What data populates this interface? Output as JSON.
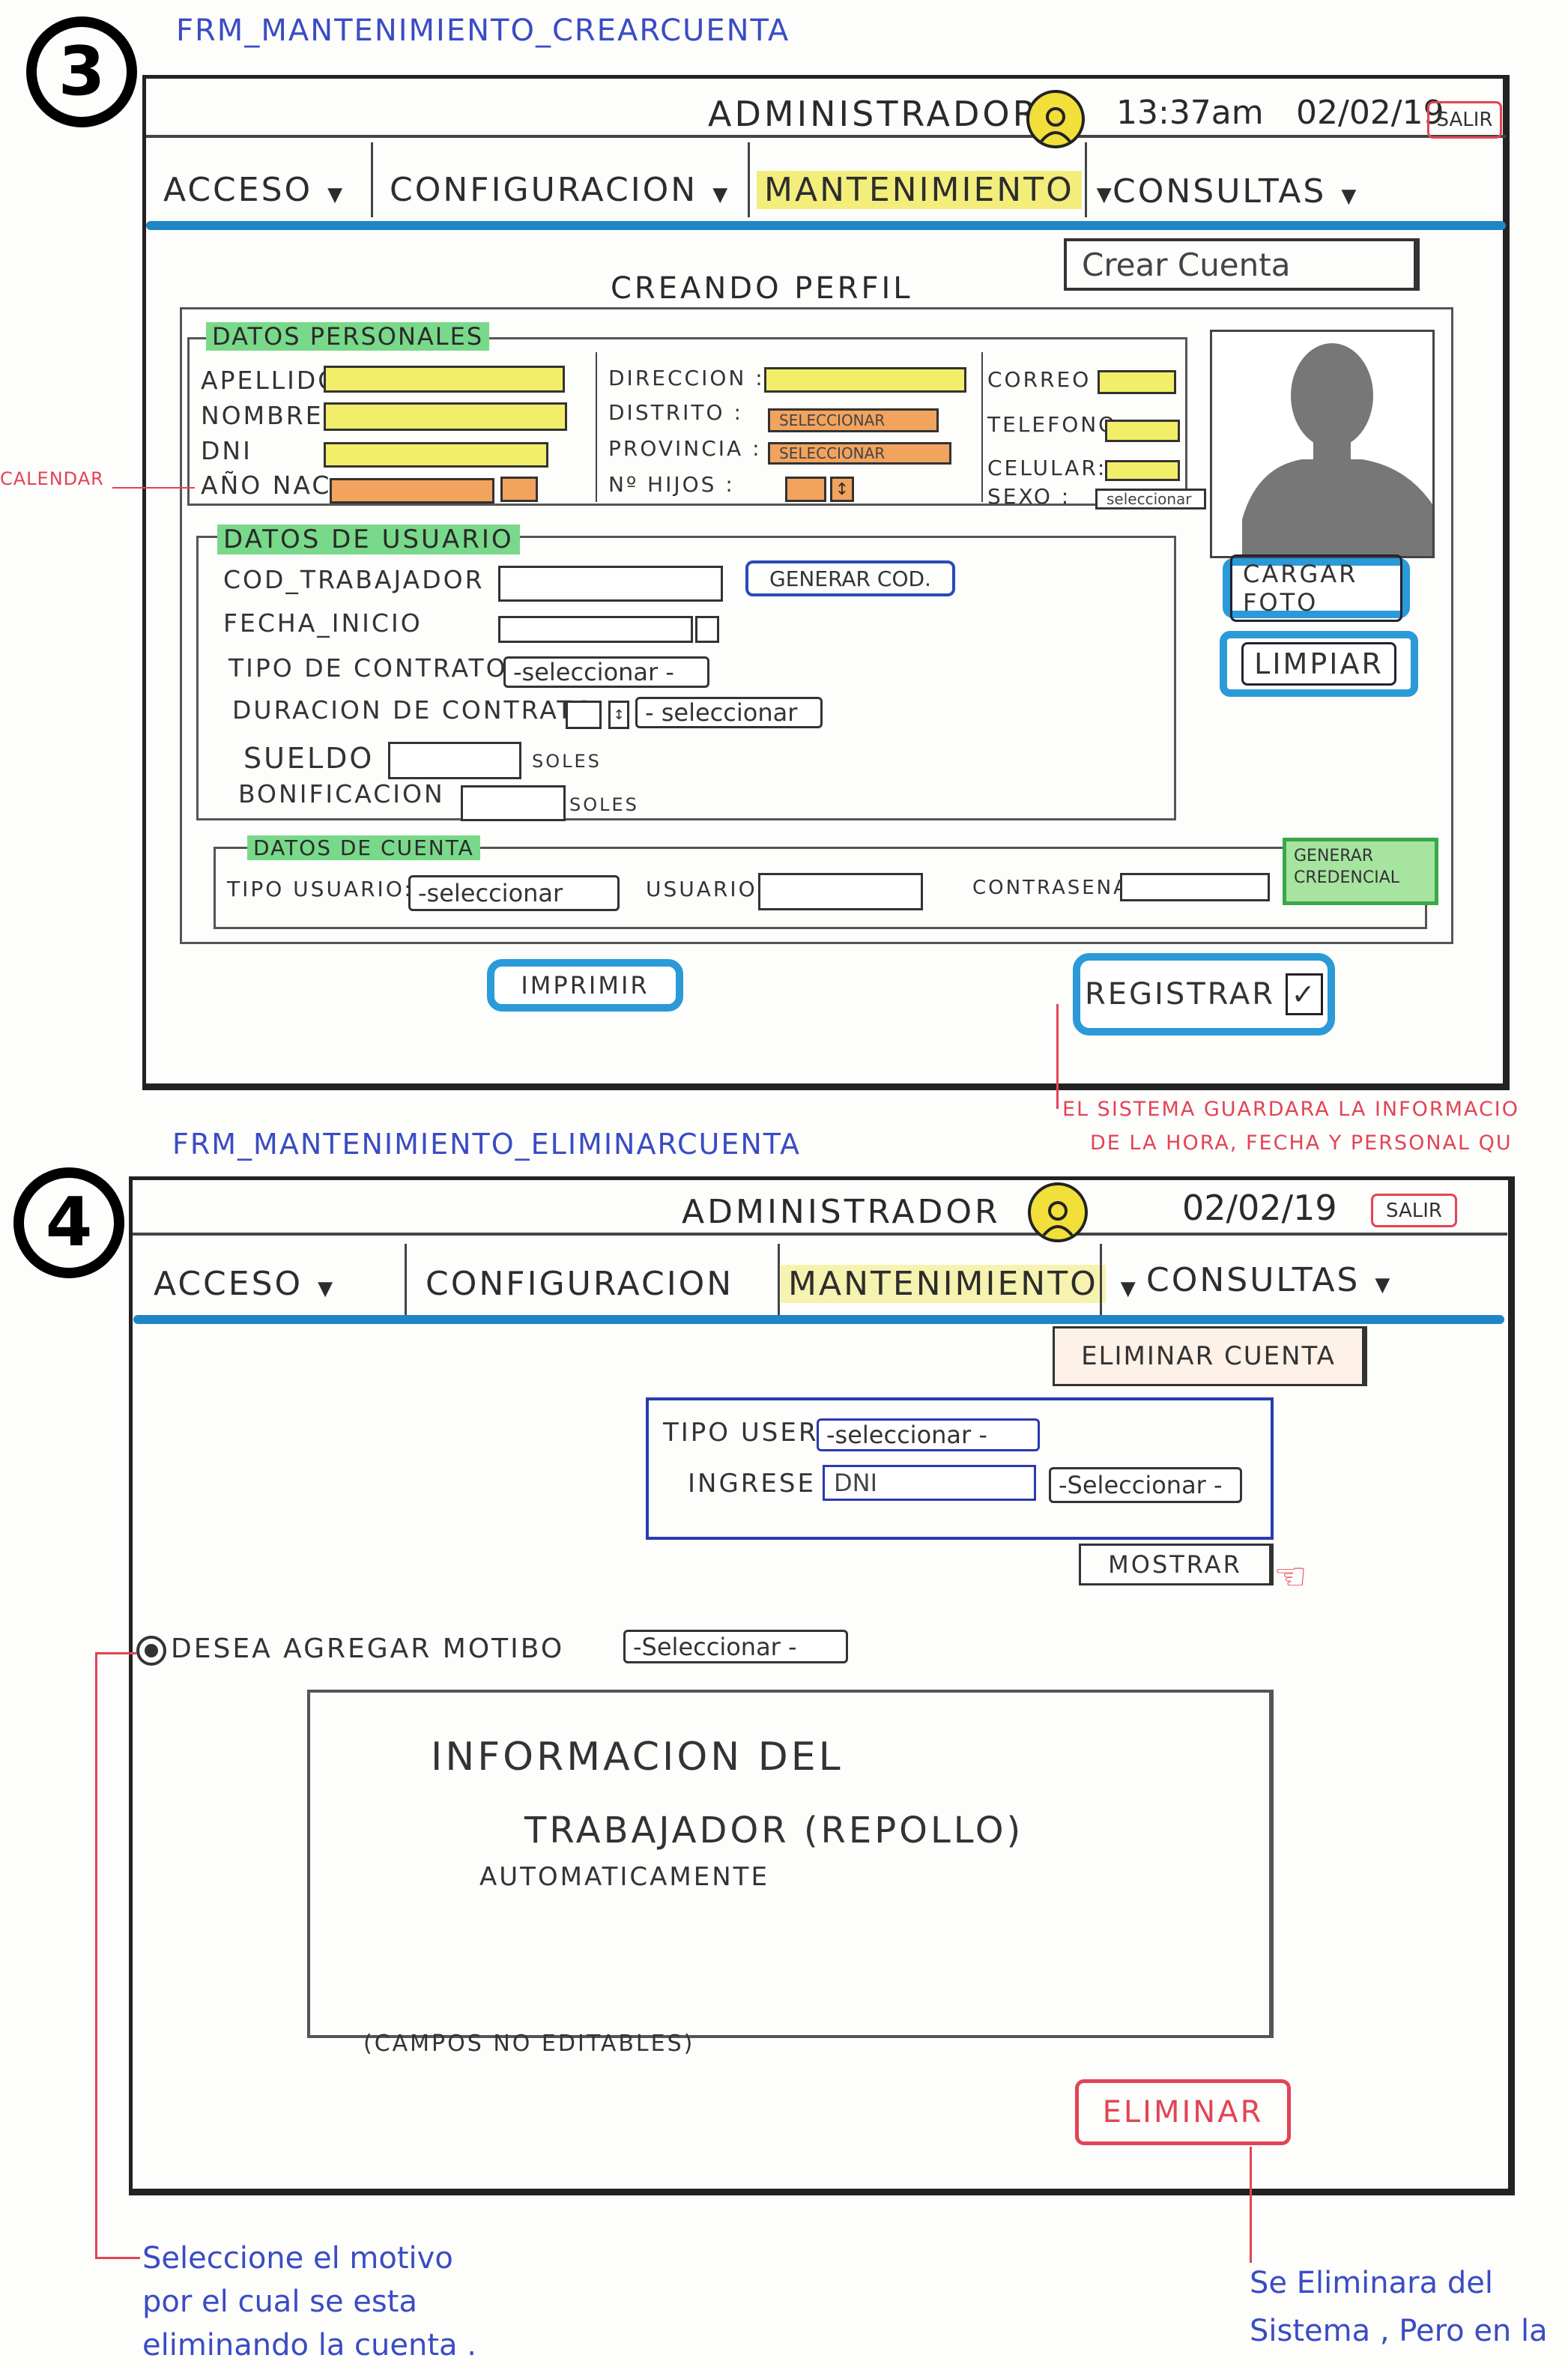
{
  "screen3": {
    "number": "3",
    "form_name": "FRM_MANTENIMIENTO_CREARCUENTA",
    "header": {
      "user_role": "ADMINISTRADOR",
      "time": "13:37am",
      "date": "02/02/19",
      "logout_label": "SALIR"
    },
    "menu": {
      "acceso": "ACCESO",
      "configuracion": "CONFIGURACION",
      "mantenimiento": "MANTENIMIENTO",
      "consultas": "CONSULTAS"
    },
    "submenu_item": "Crear Cuenta",
    "page_title": "CREANDO PERFIL",
    "datos_personales": {
      "title": "DATOS PERSONALES",
      "apellido": "APELLIDO",
      "nombre": "NOMBRE",
      "dni": "DNI",
      "ano_nac": "AÑO NAC",
      "direccion": "DIRECCION :",
      "distrito": "DISTRITO :",
      "distrito_value": "SELECCIONAR",
      "provincia": "PROVINCIA :",
      "provincia_value": "SELECCIONAR",
      "n_hijos": "Nº HIJOS :",
      "correo": "CORREO :",
      "telefono": "TELEFONO:",
      "celular": "CELULAR:",
      "sexo": "SEXO :",
      "sexo_value": "seleccionar"
    },
    "calendar_note": "CALENDAR",
    "photo_buttons": {
      "cargar_foto": "CARGAR FOTO",
      "limpiar": "LIMPIAR"
    },
    "datos_usuario": {
      "title": "DATOS DE USUARIO",
      "cod_trabajador": "COD_TRABAJADOR",
      "generar_cod": "GENERAR COD.",
      "fecha_inicio": "FECHA_INICIO",
      "tipo_contrato": "TIPO DE CONTRATO",
      "tipo_contrato_value": "-seleccionar -",
      "duracion_contrato": "DURACION DE CONTRATO",
      "duracion_value": "- seleccionar",
      "sueldo": "SUELDO",
      "soles1": "SOLES",
      "bonificacion": "BONIFICACION",
      "soles2": "SOLES"
    },
    "datos_cuenta": {
      "title": "DATOS DE CUENTA",
      "tipo_usuario": "TIPO USUARIO:",
      "tipo_usuario_value": "-seleccionar",
      "usuario": "USUARIO",
      "contrasena": "CONTRASENA",
      "generar_credencial": "GENERAR CREDENCIAL"
    },
    "imprimir": "IMPRIMIR",
    "registrar": "REGISTRAR",
    "registrar_note_1": "EL SISTEMA GUARDARA LA INFORMACIO",
    "registrar_note_2": "DE LA HORA, FECHA Y PERSONAL QU"
  },
  "screen4": {
    "number": "4",
    "form_name": "FRM_MANTENIMIENTO_ELIMINARCUENTA",
    "header": {
      "user_role": "ADMINISTRADOR",
      "date": "02/02/19",
      "logout_label": "SALIR"
    },
    "menu": {
      "acceso": "ACCESO",
      "configuracion": "CONFIGURACION",
      "mantenimiento": "MANTENIMIENTO",
      "consultas": "CONSULTAS"
    },
    "submenu_item": "ELIMINAR CUENTA",
    "search": {
      "tipo_user": "TIPO USER",
      "tipo_user_value": "-seleccionar -",
      "ingrese": "INGRESE",
      "ingrese_value": "DNI",
      "ingrese_select": "-Seleccionar -"
    },
    "mostrar": "MOSTRAR",
    "motivo": {
      "label": "DESEA AGREGAR MOTIBO",
      "value": "-Seleccionar -"
    },
    "info_box": {
      "line1": "INFORMACION DEL",
      "line2": "TRABAJADOR (REPOLLO)",
      "line3": "AUTOMATICAMENTE",
      "footer": "(CAMPOS NO EDITABLES)"
    },
    "eliminar": "ELIMINAR",
    "motivo_note": [
      "Seleccione el motivo",
      "por el cual se esta",
      "eliminando la cuenta ."
    ],
    "eliminar_note": [
      "Se Eliminara del",
      "Sistema , Pero en la"
    ]
  },
  "colors": {
    "accent_blue": "#1f86c6",
    "highlight_yellow": "#f3ee6a",
    "highlight_green": "#79d98a",
    "orange": "#f2a35e",
    "annotation_red": "#e24455",
    "pen_blue": "#3a4cc4"
  }
}
